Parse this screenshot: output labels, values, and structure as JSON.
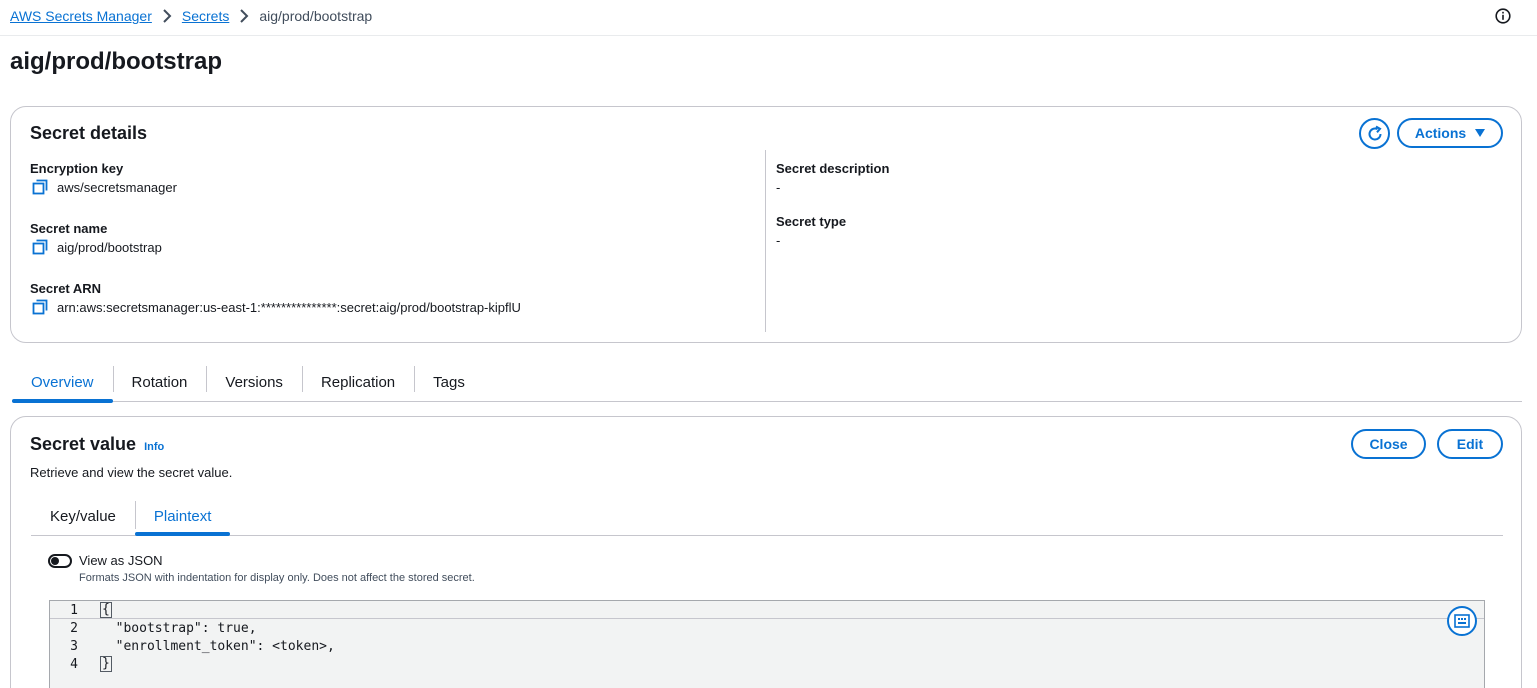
{
  "breadcrumb": {
    "root": "AWS Secrets Manager",
    "secrets": "Secrets",
    "current": "aig/prod/bootstrap"
  },
  "page": {
    "title": "aig/prod/bootstrap"
  },
  "details": {
    "title": "Secret details",
    "actions_label": "Actions",
    "left": [
      {
        "label": "Encryption key",
        "value": "aws/secretsmanager"
      },
      {
        "label": "Secret name",
        "value": "aig/prod/bootstrap"
      },
      {
        "label": "Secret ARN",
        "value": "arn:aws:secretsmanager:us-east-1:***************:secret:aig/prod/bootstrap-kipflU"
      }
    ],
    "right": [
      {
        "label": "Secret description",
        "value": "-"
      },
      {
        "label": "Secret type",
        "value": "-"
      }
    ]
  },
  "tabs": [
    "Overview",
    "Rotation",
    "Versions",
    "Replication",
    "Tags"
  ],
  "active_tab": "Overview",
  "secret_value": {
    "title": "Secret value",
    "info": "Info",
    "description": "Retrieve and view the secret value.",
    "close_label": "Close",
    "edit_label": "Edit",
    "subtabs": [
      "Key/value",
      "Plaintext"
    ],
    "active_subtab": "Plaintext",
    "toggle_label": "View as JSON",
    "toggle_on": false,
    "toggle_description": "Formats JSON with indentation for display only. Does not affect the stored secret.",
    "code": {
      "line_numbers": [
        "1",
        "2",
        "3",
        "4"
      ],
      "lines": [
        "{",
        "  \"bootstrap\": true,",
        "  \"enrollment_token\": <token>,",
        "}"
      ]
    }
  },
  "colors": {
    "accent": "#0972d3",
    "text": "#16191f",
    "border": "#c6c6cd"
  }
}
